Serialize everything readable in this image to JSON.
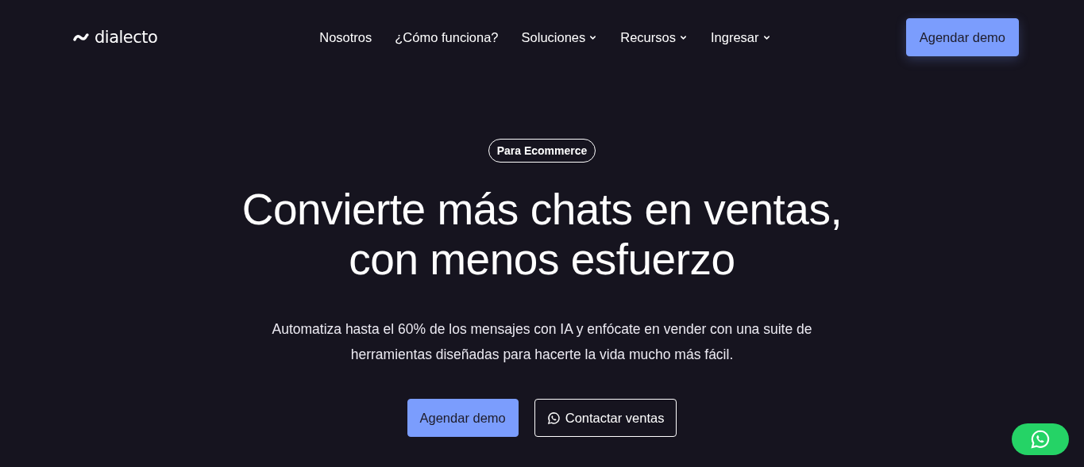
{
  "header": {
    "logo": "dialecto",
    "nav": [
      {
        "label": "Nosotros",
        "kind": "link"
      },
      {
        "label": "¿Cómo funciona?",
        "kind": "link"
      },
      {
        "label": "Soluciones",
        "kind": "dropdown"
      },
      {
        "label": "Recursos",
        "kind": "dropdown"
      },
      {
        "label": "Ingresar",
        "kind": "dropdown"
      }
    ],
    "cta": "Agendar demo"
  },
  "hero": {
    "badge": "Para Ecommerce",
    "title_lines": [
      "Convierte más chats en ventas,",
      "con menos esfuerzo"
    ],
    "subtitle": "Automatiza hasta el 60% de los mensajes con IA y enfócate en vender con una suite de herramientas diseñadas para hacerte la vida mucho más fácil.",
    "buttons": [
      {
        "label": "Agendar demo",
        "kind": "primary"
      },
      {
        "label": "Contactar ventas",
        "kind": "outline"
      }
    ]
  },
  "floating_chat": {
    "kind": "whatsapp"
  }
}
